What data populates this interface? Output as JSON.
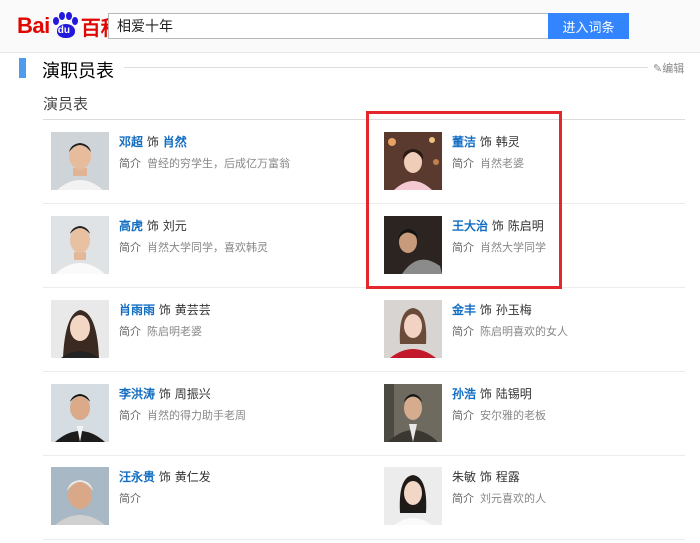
{
  "header": {
    "logo_bai": "Bai",
    "logo_du": "du",
    "logo_baike": "百科",
    "search_value": "相爱十年",
    "search_button": "进入词条"
  },
  "section": {
    "title": "演职员表",
    "edit": "编辑",
    "subtitle": "演员表"
  },
  "cast": [
    {
      "actor": "邓超",
      "as": "饰",
      "role": "肖然",
      "intro_label": "简介",
      "intro": "曾经的穷学生，后成亿万富翁"
    },
    {
      "actor": "董洁",
      "as": "饰",
      "role": "韩灵",
      "intro_label": "简介",
      "intro": "肖然老婆"
    },
    {
      "actor": "高虎",
      "as": "饰",
      "role": "刘元",
      "intro_label": "简介",
      "intro": "肖然大学同学，喜欢韩灵"
    },
    {
      "actor": "王大治",
      "as": "饰",
      "role": "陈启明",
      "intro_label": "简介",
      "intro": "肖然大学同学"
    },
    {
      "actor": "肖雨雨",
      "as": "饰",
      "role": "黄芸芸",
      "intro_label": "简介",
      "intro": "陈启明老婆"
    },
    {
      "actor": "金丰",
      "as": "饰",
      "role": "孙玉梅",
      "intro_label": "简介",
      "intro": "陈启明喜欢的女人"
    },
    {
      "actor": "李洪涛",
      "as": "饰",
      "role": "周振兴",
      "intro_label": "简介",
      "intro": "肖然的得力助手老周"
    },
    {
      "actor": "孙浩",
      "as": "饰",
      "role": "陆锡明",
      "intro_label": "简介",
      "intro": "安尔雅的老板"
    },
    {
      "actor": "汪永贵",
      "as": "饰",
      "role": "黄仁发",
      "intro_label": "简介",
      "intro": ""
    },
    {
      "actor": "朱敏",
      "as": "饰",
      "role": "程露",
      "intro_label": "简介",
      "intro": "刘元喜欢的人"
    }
  ],
  "colors": {
    "accent": "#3385ff",
    "link": "#136ec2",
    "highlight": "#e5272d",
    "logo_red": "#e10601",
    "logo_blue": "#2319dc"
  }
}
